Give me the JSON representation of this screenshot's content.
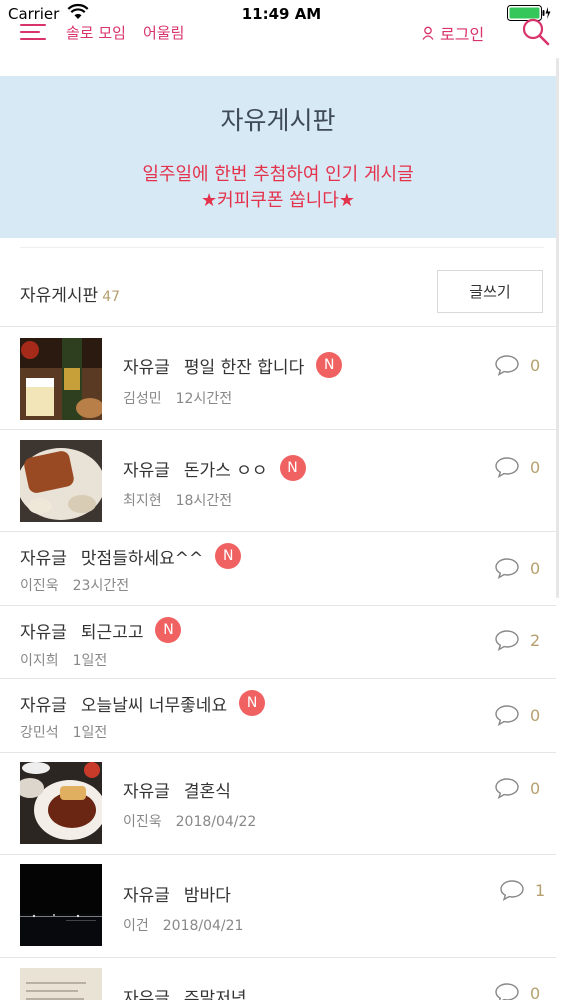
{
  "status": {
    "carrier": "Carrier",
    "time": "11:49 AM"
  },
  "nav": {
    "solo": "솔로 모임",
    "match": "어울림",
    "login": "로그인"
  },
  "banner": {
    "title": "자유게시판",
    "line1": "일주일에 한번 추첨하여 인기 게시글",
    "line2": "★커피쿠폰 쏩니다★"
  },
  "board": {
    "name": "자유게시판",
    "count": "47",
    "write": "글쓰기"
  },
  "posts": [
    {
      "category": "자유글",
      "title": "평일 한잔 합니다",
      "new": "N",
      "author": "김성민",
      "date": "12시간전",
      "comments": "0",
      "thumb": "beer"
    },
    {
      "category": "자유글",
      "title": "돈가스 ㅇㅇ",
      "new": "N",
      "author": "최지현",
      "date": "18시간전",
      "comments": "0",
      "thumb": "pork-cutlet"
    },
    {
      "category": "자유글",
      "title": "맛점들하세요^^",
      "new": "N",
      "author": "이진욱",
      "date": "23시간전",
      "comments": "0"
    },
    {
      "category": "자유글",
      "title": "퇴근고고",
      "new": "N",
      "author": "이지희",
      "date": "1일전",
      "comments": "2"
    },
    {
      "category": "자유글",
      "title": "오늘날씨 너무좋네요",
      "new": "N",
      "author": "강민석",
      "date": "1일전",
      "comments": "0"
    },
    {
      "category": "자유글",
      "title": "결혼식",
      "author": "이진욱",
      "date": "2018/04/22",
      "comments": "0",
      "thumb": "wedding-meal"
    },
    {
      "category": "자유글",
      "title": "밤바다",
      "author": "이건",
      "date": "2018/04/21",
      "comments": "1",
      "thumb": "night-sea"
    },
    {
      "category": "자유글",
      "title": "주말저녁",
      "comments": "0",
      "thumb": "book-page"
    }
  ],
  "colors": {
    "accent": "#d8336b",
    "banner_bg": "#d8e9f6",
    "banner_text": "#e3334c",
    "badge": "#f06161",
    "count": "#b6a06f"
  },
  "icons": [
    "menu-icon",
    "wifi-icon",
    "battery-icon",
    "user-icon",
    "search-icon",
    "comment-icon"
  ]
}
